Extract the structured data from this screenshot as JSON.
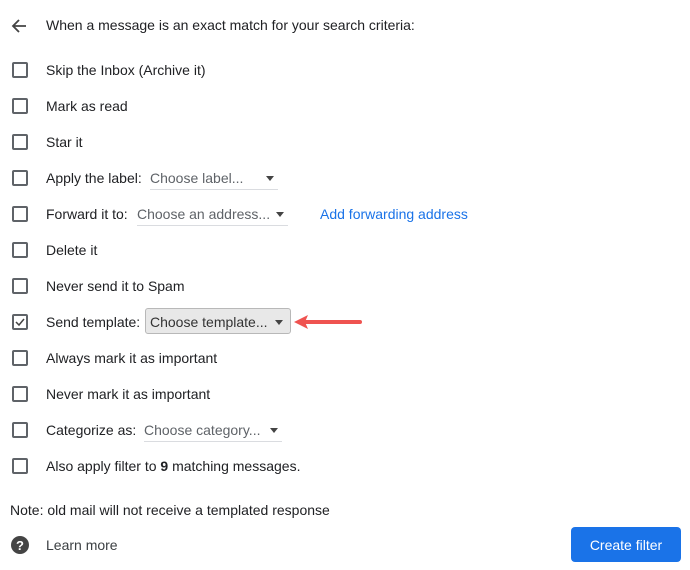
{
  "header": {
    "title": "When a message is an exact match for your search criteria:",
    "back_icon": "arrow-left-icon"
  },
  "options": [
    {
      "label": "Skip the Inbox (Archive it)",
      "checked": false
    },
    {
      "label": "Mark as read",
      "checked": false
    },
    {
      "label": "Star it",
      "checked": false
    },
    {
      "label": "Apply the label:",
      "checked": false,
      "dropdown": "Choose label..."
    },
    {
      "label": "Forward it to:",
      "checked": false,
      "dropdown": "Choose an address...",
      "link": "Add forwarding address"
    },
    {
      "label": "Delete it",
      "checked": false
    },
    {
      "label": "Never send it to Spam",
      "checked": false
    },
    {
      "label": "Send template:",
      "checked": true,
      "dropdown": "Choose template..."
    },
    {
      "label": "Always mark it as important",
      "checked": false
    },
    {
      "label": "Never mark it as important",
      "checked": false
    },
    {
      "label": "Categorize as:",
      "checked": false,
      "dropdown": "Choose category..."
    },
    {
      "label_prefix": "Also apply filter to ",
      "count": "9",
      "label_suffix": " matching messages.",
      "checked": false
    }
  ],
  "note": "Note: old mail will not receive a templated response",
  "footer": {
    "learn_more": "Learn more",
    "create_filter": "Create filter"
  },
  "colors": {
    "accent": "#1a73e8",
    "arrow": "#ef5350"
  }
}
